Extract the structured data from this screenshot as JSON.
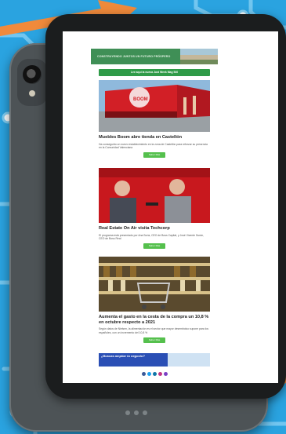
{
  "email": {
    "banner_text": "CONSTRUYENDO JUNTOS UN FUTURO PRÓSPERO",
    "cta_top": "Lee aquí la nueva Just Week Mag 540",
    "articles": [
      {
        "title": "Muebles Boom abre tienda en Castellón",
        "text": "Ha conseguido un nuevo establecimiento en la zona de Castellón para reforzar su presencia en la Comunidad Valenciana",
        "button": "Saber Más"
      },
      {
        "title": "Real Estate On Air visita Techcorp",
        "text": "El programa está presentado por Ana Soria, CEO de Boss Capital, y José Vicente Durán, CEO de Boss Real",
        "button": "Saber Más"
      },
      {
        "title": "Aumenta el gasto en la cesta de la compra un 10,8 % en octubre respecto a 2021",
        "text": "Según datos de Nielsen, la alimentación es el sector que mayor desembolso supone para los españoles, con un incremento del 10,8 %",
        "button": "Saber Más"
      }
    ],
    "promo_text": "¿Buscas ampliar tu negocio?",
    "store_sign": "BOOM"
  },
  "colors": {
    "background": "#2aa3e0",
    "banner": "#3f8f56",
    "cta": "#2f9b48",
    "button": "#55c04d",
    "arrow": "#f08a3b"
  }
}
